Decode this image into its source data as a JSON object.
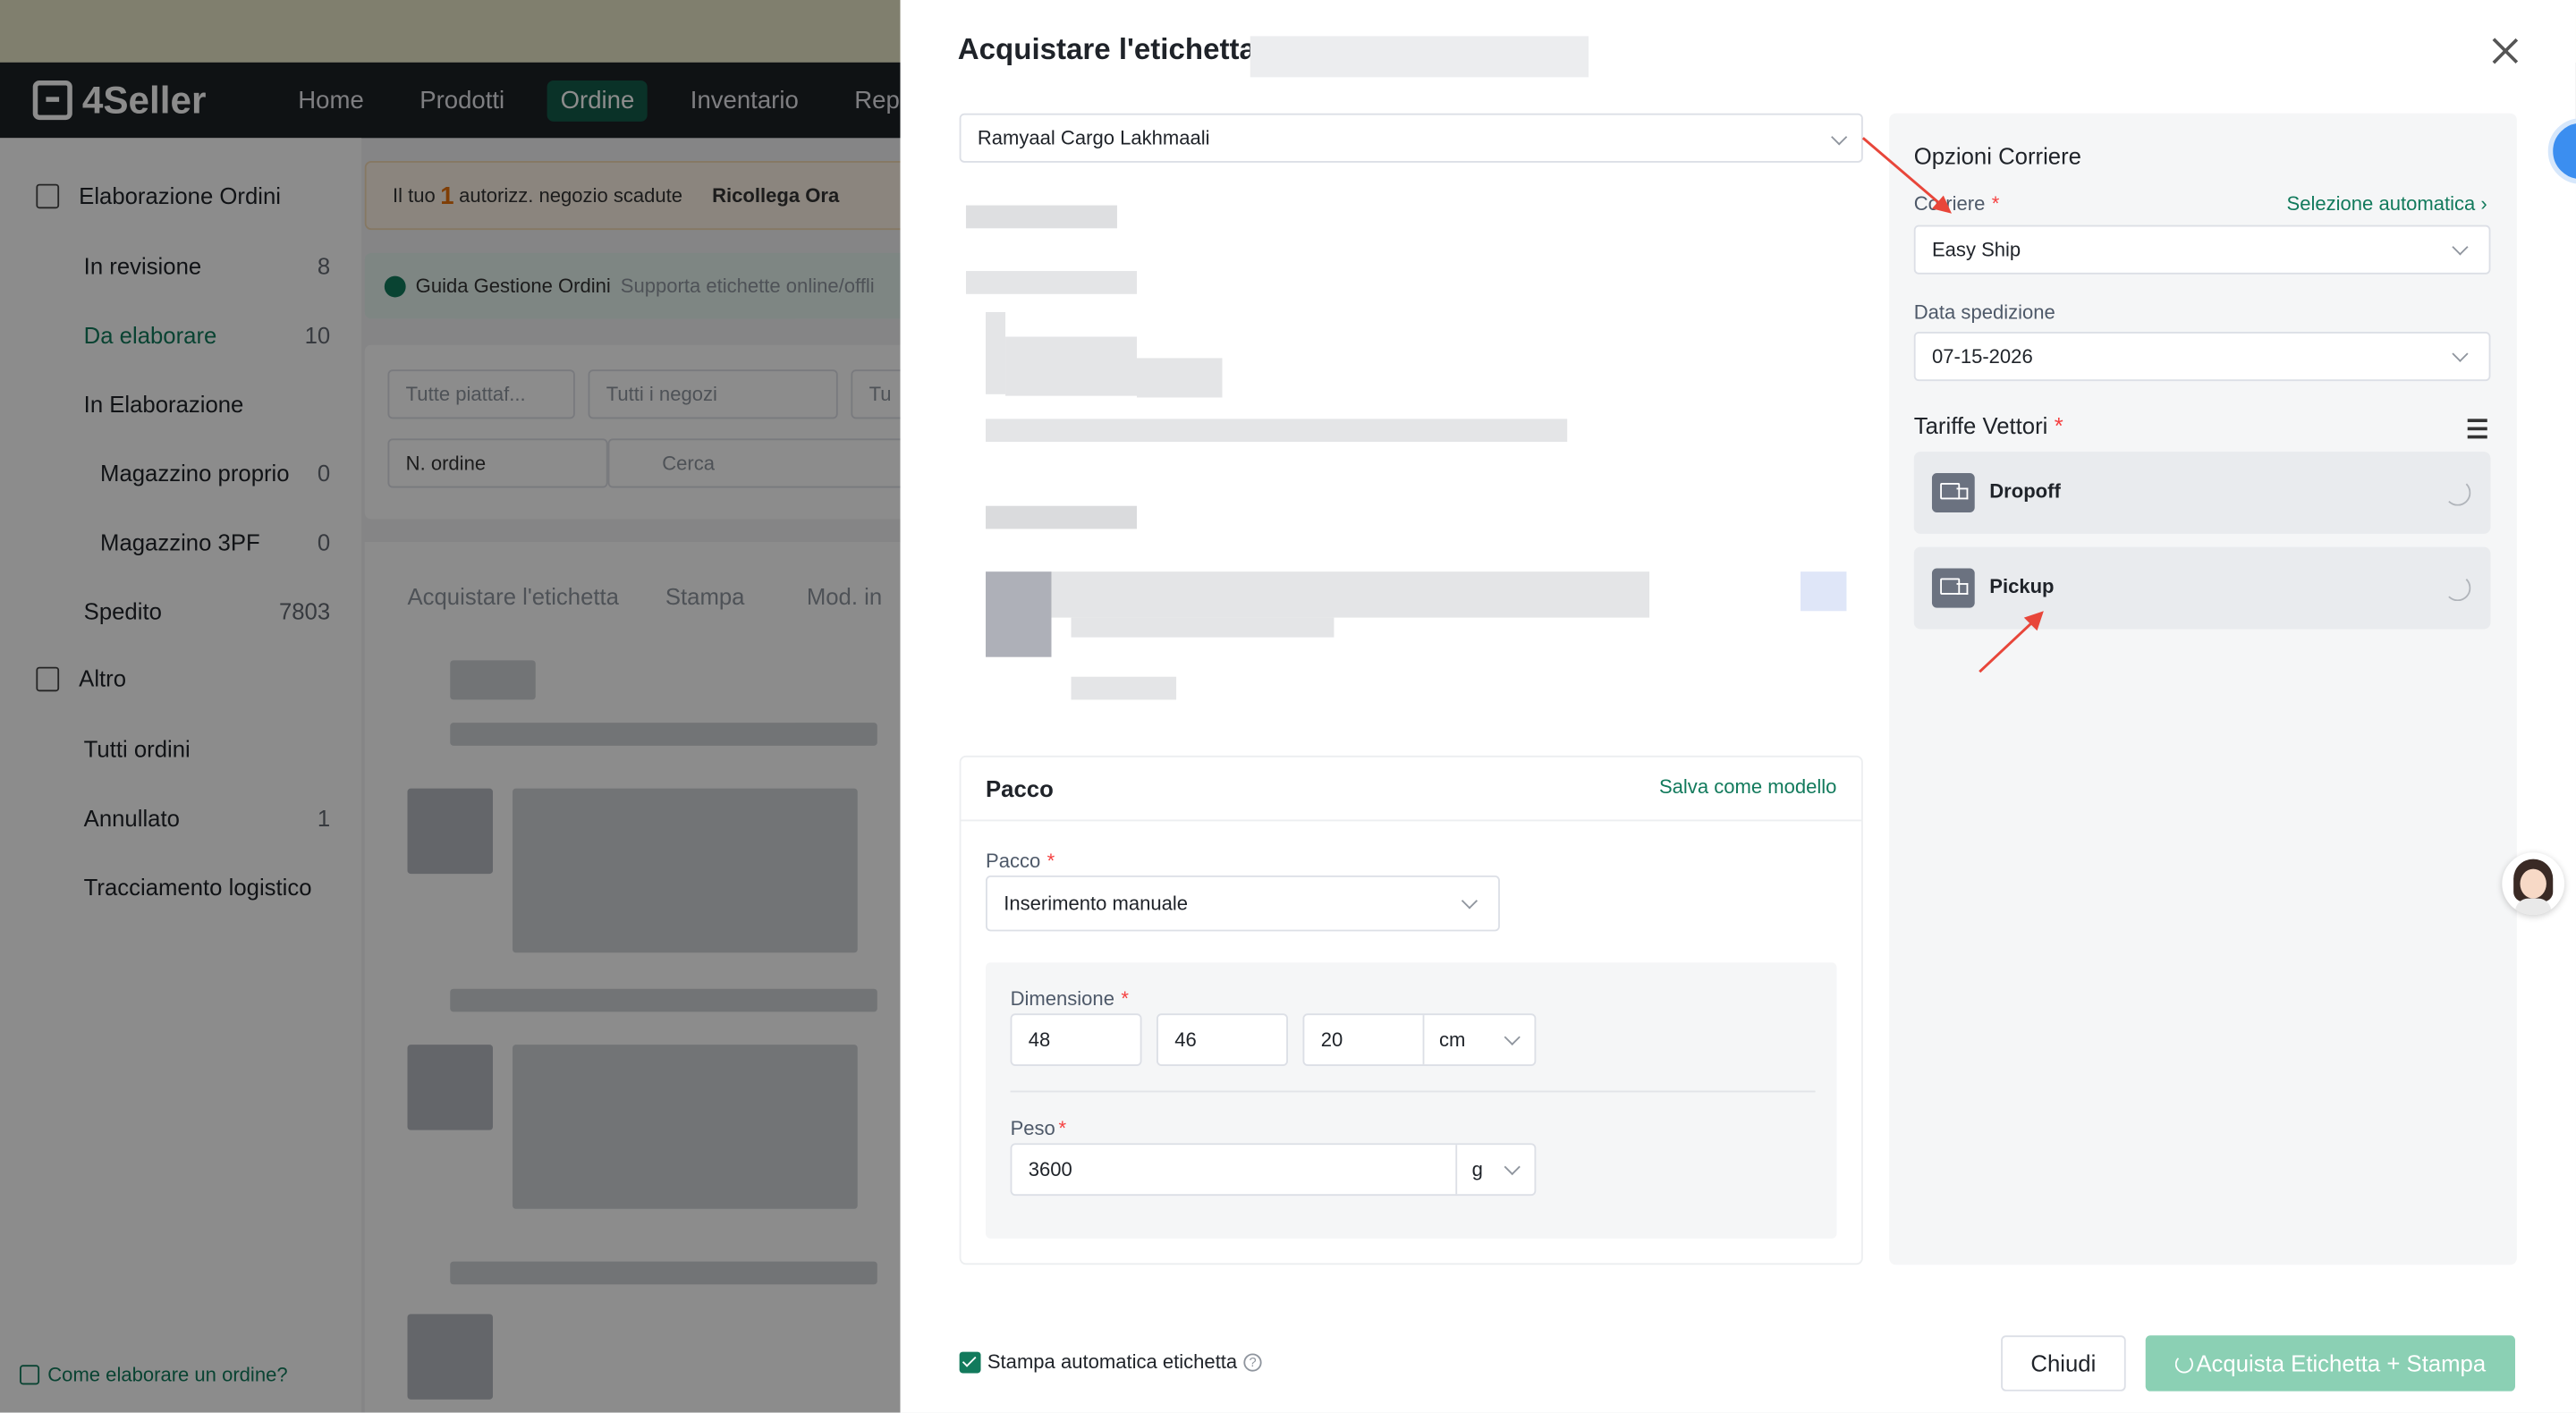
{
  "nav": {
    "brand": "4Seller",
    "items": [
      "Home",
      "Prodotti",
      "Ordine",
      "Inventario",
      "Report"
    ],
    "active": "Ordine"
  },
  "sidebar": {
    "section1": "Elaborazione Ordini",
    "items": [
      {
        "label": "In revisione",
        "count": "8"
      },
      {
        "label": "Da elaborare",
        "count": "10"
      },
      {
        "label": "In Elaborazione",
        "count": ""
      },
      {
        "label": "Magazzino proprio",
        "count": "0"
      },
      {
        "label": "Magazzino 3PF",
        "count": "0"
      },
      {
        "label": "Spedito",
        "count": "7803"
      }
    ],
    "section2": "Altro",
    "items2": [
      {
        "label": "Tutti ordini",
        "count": ""
      },
      {
        "label": "Annullato",
        "count": "1"
      },
      {
        "label": "Tracciamento logistico",
        "count": ""
      }
    ],
    "footer_link": "Come elaborare un ordine?"
  },
  "background": {
    "warn_prefix": "Il tuo",
    "warn_num": "1",
    "warn_text": "autorizz. negozio scadute",
    "warn_link": "Ricollega Ora",
    "guide_title": "Guida Gestione Ordini",
    "guide_sub": "Supporta etichette online/offli",
    "filter1": "Tutte piattaf...",
    "filter2": "Tutti i negozi",
    "filter3": "Tu",
    "search_type": "N. ordine",
    "search_placeholder": "Cerca",
    "tab1": "Acquistare l'etichetta",
    "tab2": "Stampa",
    "tab3": "Mod. in"
  },
  "drawer": {
    "title": "Acquistare l'etichetta",
    "address_select": "Ramyaal Cargo Lakhmaali",
    "package": {
      "heading": "Pacco",
      "save_template": "Salva come modello",
      "pacco_label": "Pacco",
      "pacco_value": "Inserimento manuale",
      "dim_label": "Dimensione",
      "length": "48",
      "width": "46",
      "height": "20",
      "dim_unit": "cm",
      "weight_label": "Peso",
      "weight": "3600",
      "weight_unit": "g"
    },
    "carrier": {
      "heading": "Opzioni Corriere",
      "carrier_label": "Corriere",
      "auto_select": "Selezione automatica",
      "carrier_value": "Easy Ship",
      "date_label": "Data spedizione",
      "date_value": "07-15-2026",
      "rates_label": "Tariffe Vettori",
      "rates": [
        "Dropoff",
        "Pickup"
      ]
    },
    "footer": {
      "auto_print": "Stampa automatica etichetta",
      "close": "Chiudi",
      "buy": "Acquista Etichetta + Stampa"
    }
  },
  "colors": {
    "brand": "#127a5c",
    "navbar": "#1d2125",
    "annotation_arrow": "#e8463a"
  }
}
